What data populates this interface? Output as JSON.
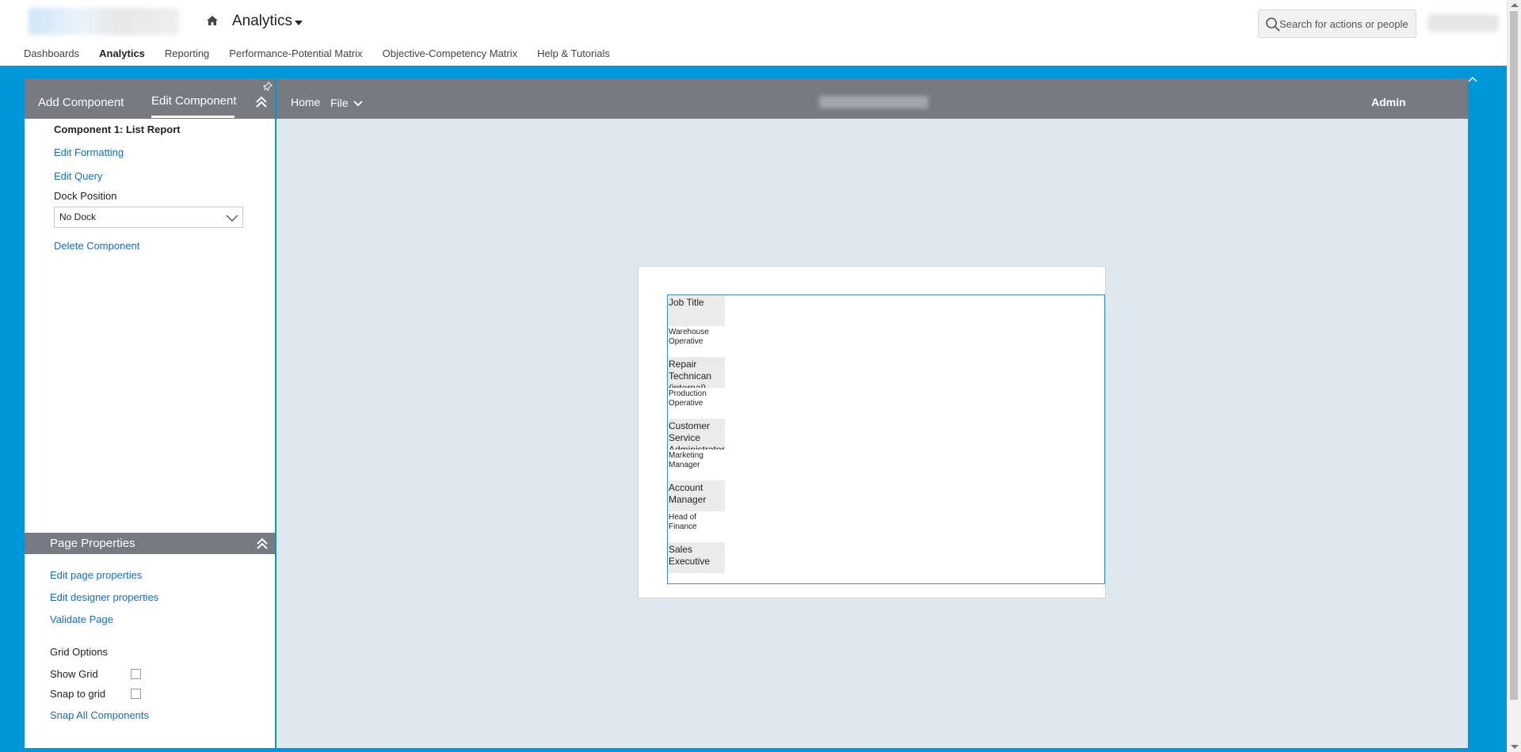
{
  "header": {
    "app_title": "Analytics",
    "search_placeholder": "Search for actions or people"
  },
  "nav": {
    "items": [
      "Dashboards",
      "Analytics",
      "Reporting",
      "Performance-Potential Matrix",
      "Objective-Competency Matrix",
      "Help & Tutorials"
    ],
    "active": "Analytics"
  },
  "left_panel": {
    "tabs": {
      "add": "Add Component",
      "edit": "Edit Component"
    },
    "component_title": "Component 1: List Report",
    "edit_formatting": "Edit Formatting",
    "edit_query": "Edit Query",
    "dock_label": "Dock Position",
    "dock_value": "No Dock",
    "delete": "Delete Component"
  },
  "page_properties": {
    "title": "Page Properties",
    "edit_page": "Edit page properties",
    "edit_designer": "Edit designer properties",
    "validate": "Validate Page",
    "grid_options": "Grid Options",
    "show_grid": "Show Grid",
    "snap_to_grid": "Snap to grid",
    "snap_all": "Snap All Components"
  },
  "canvas_header": {
    "home": "Home",
    "file": "File",
    "admin": "Admin"
  },
  "report": {
    "header_cells": [
      "Job Title",
      "Repair Technican (internal)",
      "Customer Service Administrator",
      "Account Manager",
      "Sales Executive"
    ],
    "row_cells": [
      "Warehouse Operative",
      "Production Operative",
      "Marketing Manager",
      "Head of Finance"
    ]
  },
  "colors": {
    "brand_blue": "#0097d9",
    "panel_gray": "#787a82",
    "link_blue": "#1a6db5",
    "canvas_bg": "#dfe8ee"
  }
}
